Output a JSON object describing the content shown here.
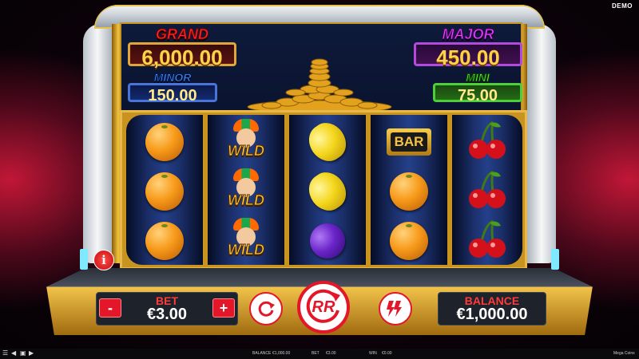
{
  "demo_label": "DEMO",
  "jackpots": {
    "grand": {
      "label": "GRAND",
      "amount": "6,000.00"
    },
    "major": {
      "label": "MAJOR",
      "amount": "450.00"
    },
    "minor": {
      "label": "MINOR",
      "amount": "150.00"
    },
    "mini": {
      "label": "MINI",
      "amount": "75.00"
    }
  },
  "reels": [
    [
      "orange",
      "orange",
      "orange"
    ],
    [
      "wild",
      "wild",
      "wild"
    ],
    [
      "lemon",
      "lemon",
      "plum"
    ],
    [
      "bar",
      "orange",
      "orange"
    ],
    [
      "cherry",
      "cherry",
      "cherry"
    ]
  ],
  "symbols": {
    "bar_text": "BAR",
    "wild_text": "WILD"
  },
  "controls": {
    "info_label": "i",
    "bet_label": "BET",
    "bet_value": "€3.00",
    "minus_label": "-",
    "plus_label": "+",
    "spin_label": "RR",
    "balance_label": "BALANCE",
    "balance_value": "€1,000.00"
  },
  "status_bar": {
    "balance_label": "BALANCE",
    "balance_value": "€1,000.00",
    "bet_label": "BET",
    "bet_value": "€3.00",
    "win_label": "WIN",
    "win_value": "€0.00",
    "game_title": "Mega Coins"
  },
  "icons": [
    "menu-icon",
    "volume-icon",
    "fullscreen-icon",
    "play-icon",
    "info-icon",
    "autoplay-icon",
    "spin-icon",
    "turbo-icon"
  ],
  "colors": {
    "accent": "#e3162a",
    "gold": "#e7b84a"
  }
}
